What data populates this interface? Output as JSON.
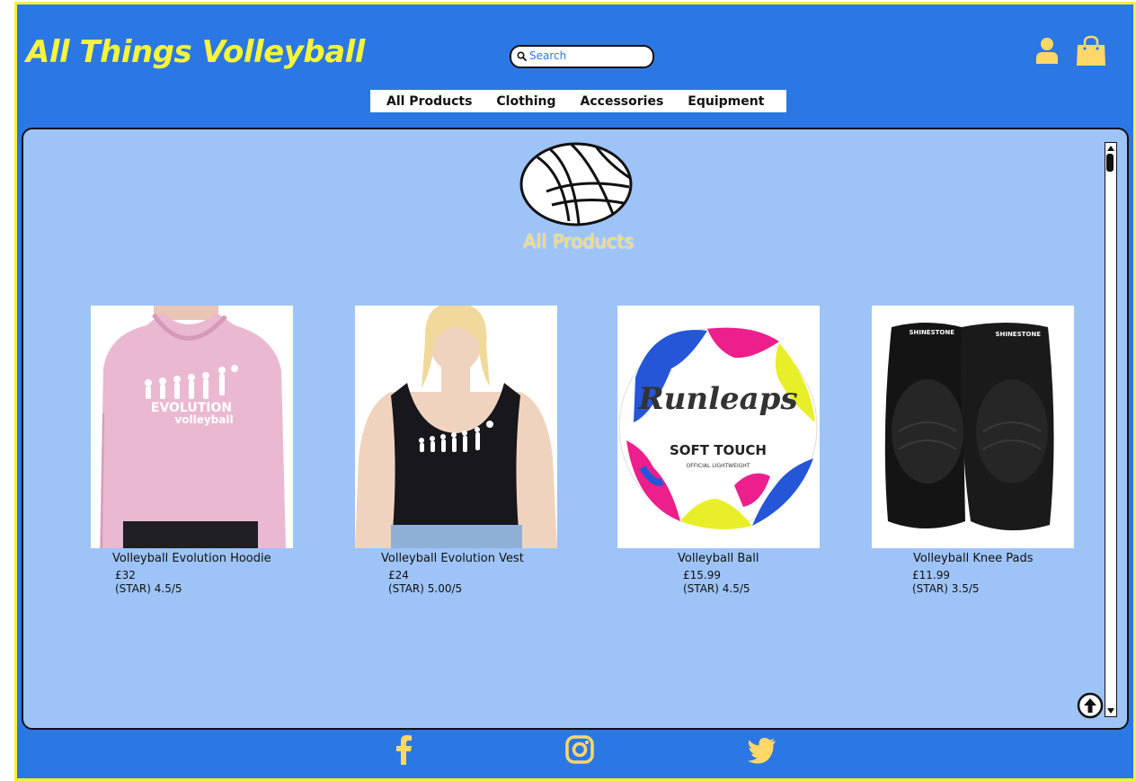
{
  "header": {
    "site_title": "All Things Volleyball",
    "search_placeholder": "Search"
  },
  "nav": {
    "items": [
      "All Products",
      "Clothing",
      "Accessories",
      "Equipment"
    ]
  },
  "main": {
    "heading": "All Products",
    "products": [
      {
        "name": "Volleyball Evolution Hoodie",
        "price": "£32",
        "rating": "(STAR) 4.5/5"
      },
      {
        "name": "Volleyball Evolution Vest",
        "price": "£24",
        "rating": "(STAR) 5.00/5"
      },
      {
        "name": "Volleyball Ball",
        "price": "£15.99",
        "rating": "(STAR) 4.5/5"
      },
      {
        "name": "Volleyball Knee Pads",
        "price": "£11.99",
        "rating": "(STAR) 3.5/5"
      }
    ]
  },
  "product_images": {
    "0": {
      "logo_line1": "EVOLUTION",
      "logo_line2": "volleyball"
    },
    "2": {
      "brand": "Runleaps",
      "label": "SOFT TOUCH",
      "small_text": "OFFICIAL  LIGHTWEIGHT"
    },
    "3": {
      "brand": "SHINESTONE"
    }
  },
  "colors": {
    "header_bg": "#2b78e4",
    "content_bg": "#9dc3f7",
    "accent_yellow": "#f7f43c",
    "icon_yellow": "#ffd867"
  },
  "icons": [
    "search-icon",
    "user-icon",
    "shopping-bag-icon",
    "volleyball-logo-icon",
    "back-to-top-icon",
    "facebook-icon",
    "instagram-icon",
    "twitter-icon"
  ]
}
